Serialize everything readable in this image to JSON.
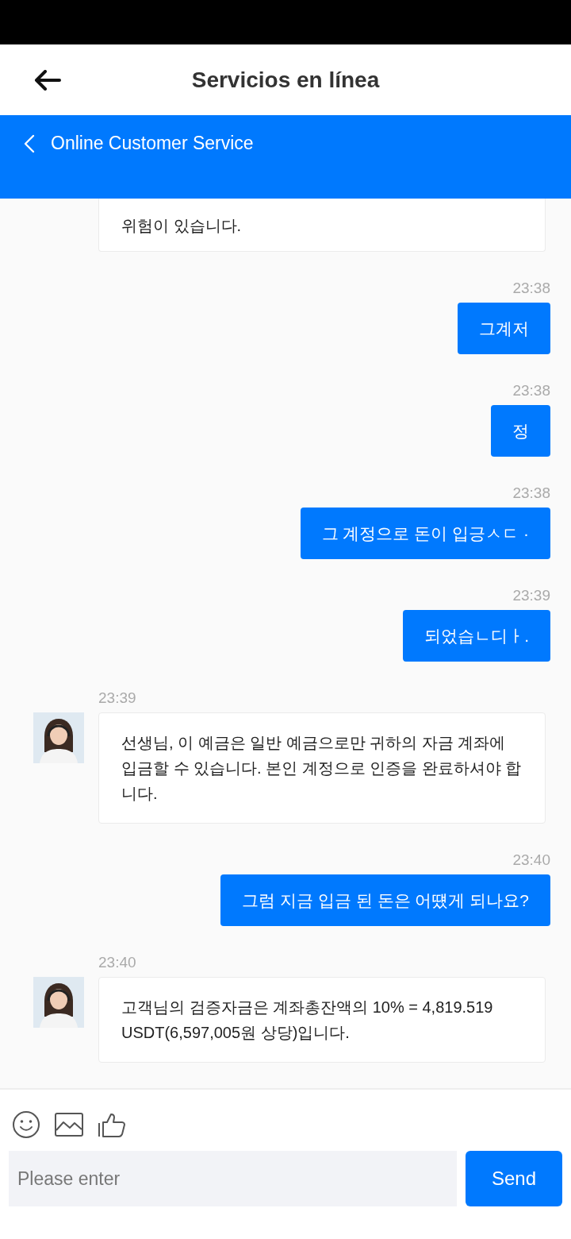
{
  "header": {
    "title": "Servicios en línea"
  },
  "service_bar": {
    "title": "Online Customer Service"
  },
  "messages": [
    {
      "kind": "continued",
      "text": "위험이 있습니다."
    },
    {
      "kind": "sent",
      "time": "23:38",
      "text": "그계저"
    },
    {
      "kind": "sent",
      "time": "23:38",
      "text": "정"
    },
    {
      "kind": "sent",
      "time": "23:38",
      "text": "그 계정으로 돈이 입긍ㅅㄷ ·"
    },
    {
      "kind": "sent",
      "time": "23:39",
      "text": "되었습ㄴ디ㅏ."
    },
    {
      "kind": "received",
      "time": "23:39",
      "text": "선생님, 이 예금은 일반 예금으로만 귀하의 자금 계좌에 입금할 수 있습니다. 본인 계정으로 인증을 완료하셔야 합니다."
    },
    {
      "kind": "sent",
      "time": "23:40",
      "text": "그럼 지금 입금 된 돈은 어떘게 되나요?"
    },
    {
      "kind": "received",
      "time": "23:40",
      "text": "고객님의 검증자금은 계좌총잔액의 10% = 4,819.519 USDT(6,597,005원 상당)입니다."
    }
  ],
  "composer": {
    "placeholder": "Please enter",
    "send": "Send"
  }
}
